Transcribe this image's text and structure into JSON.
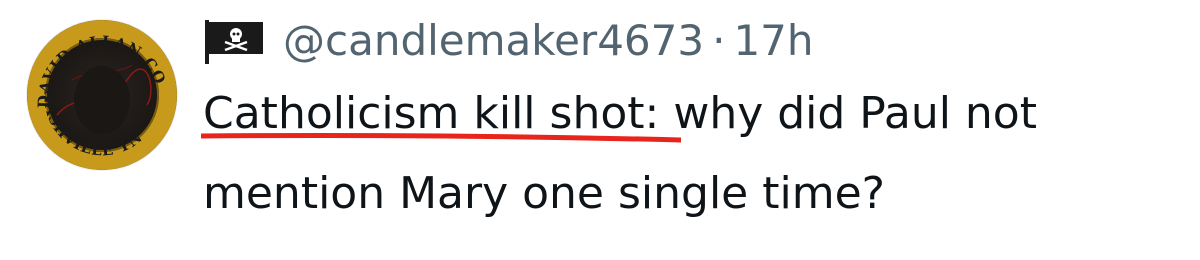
{
  "tweet": {
    "avatar": {
      "icon": "circular-badge-logo",
      "text_top": "DAVID ALLAN COE",
      "text_bottom": "NASHVILLE TN"
    },
    "flag_icon": "pirate-flag-icon",
    "handle": "@candlemaker4673",
    "separator": "·",
    "timestamp": "17h",
    "text_highlight": "Catholicism kill shot",
    "text_rest_line1": ": why did Paul not",
    "text_line2": "mention Mary one single time?",
    "underline_color": "#e8251c"
  }
}
